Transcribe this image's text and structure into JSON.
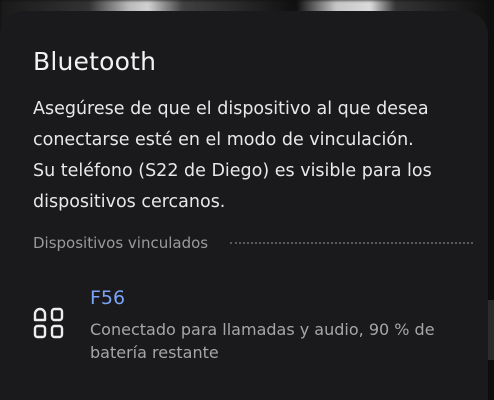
{
  "dialog": {
    "title": "Bluetooth",
    "description_lines": [
      "Asegúrese de que el dispositivo al que desea",
      "conectarse esté en el modo de vinculación.",
      "Su teléfono (S22 de Diego) es visible para los",
      "dispositivos cercanos."
    ]
  },
  "paired_section": {
    "label": "Dispositivos vinculados"
  },
  "devices": [
    {
      "name": "F56",
      "icon": "apps-grid-icon",
      "status_lines": [
        "Conectado para llamadas y audio, 90 % de",
        "batería restante"
      ]
    }
  ],
  "colors": {
    "sheet_background": "#1a1a1c",
    "accent": "#7aa3f5",
    "primary_text": "#f2f2f2",
    "secondary_text": "#a6a6a6"
  }
}
